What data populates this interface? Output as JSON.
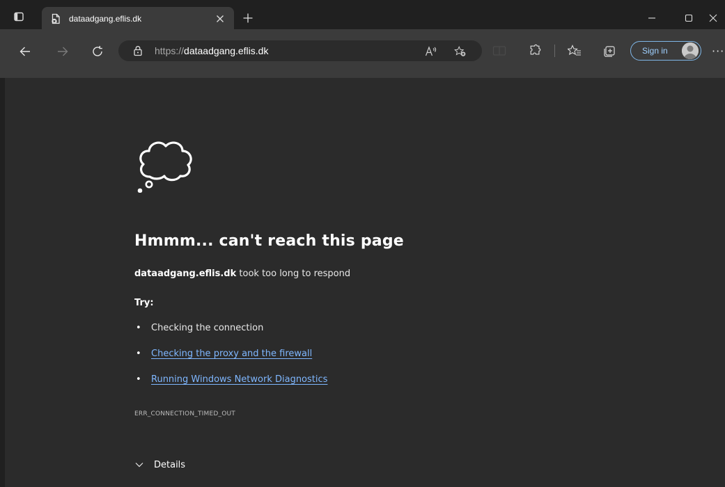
{
  "tab": {
    "title": "dataadgang.eflis.dk",
    "close_icon": "close-icon",
    "favicon": "page-error-icon"
  },
  "new_tab_label": "+",
  "address_bar": {
    "scheme": "https://",
    "host": "dataadgang.eflis.dk",
    "lock_icon": "lock-icon"
  },
  "signin": {
    "label": "Sign in"
  },
  "more_label": "···",
  "error": {
    "title": "Hmmm... can't reach this page",
    "host": "dataadgang.eflis.dk",
    "message": " took too long to respond",
    "try_heading": "Try:",
    "suggestions": [
      {
        "text": "Checking the connection",
        "link": false
      },
      {
        "text": "Checking the proxy and the firewall",
        "link": true
      },
      {
        "text": "Running Windows Network Diagnostics",
        "link": true
      }
    ],
    "bullet": "•",
    "code": "ERR_CONNECTION_TIMED_OUT",
    "details_label": "Details"
  },
  "colors": {
    "link": "#7fb7ff",
    "page_bg": "#2b2b2b",
    "chrome_bg": "#202020",
    "toolbar_bg": "#3b3b3b"
  }
}
